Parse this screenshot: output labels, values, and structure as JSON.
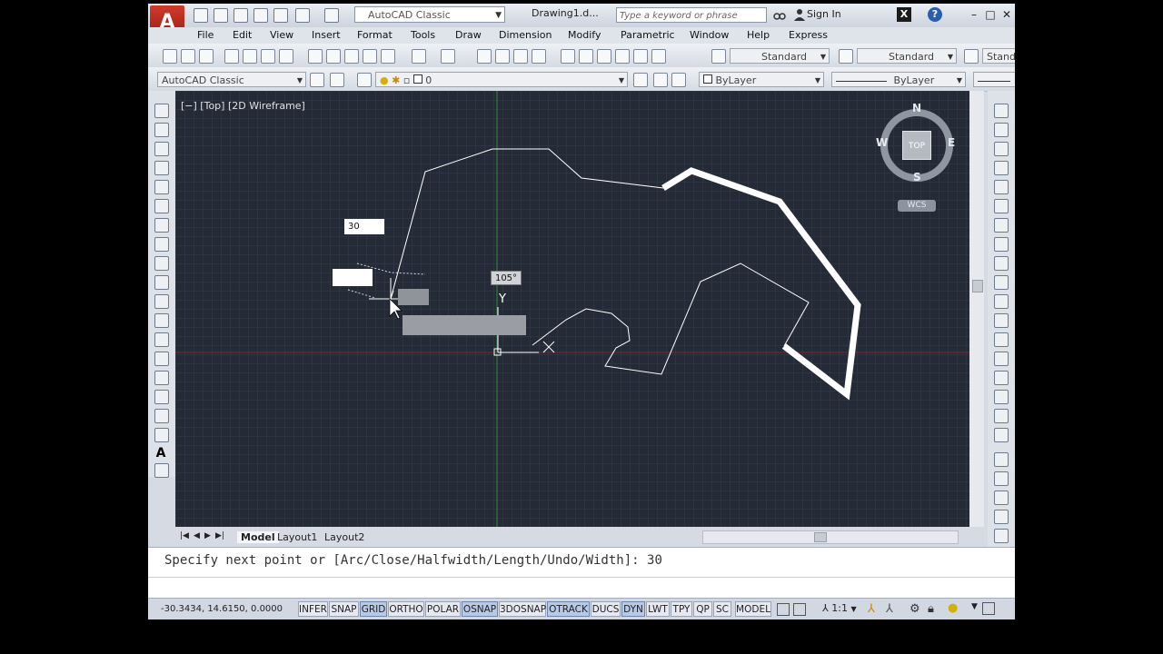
{
  "title_bar": {
    "workspace": "AutoCAD Classic",
    "document": "Drawing1.d...",
    "search_placeholder": "Type a keyword or phrase",
    "sign_in": "Sign In"
  },
  "menu": [
    "File",
    "Edit",
    "View",
    "Insert",
    "Format",
    "Tools",
    "Draw",
    "Dimension",
    "Modify",
    "Parametric",
    "Window",
    "Help",
    "Express"
  ],
  "toolbar1": {
    "text_style": "Standard",
    "dim_style": "Standard",
    "table_style": "Stand"
  },
  "toolbar2": {
    "workspace": "AutoCAD Classic",
    "layer": "0",
    "color": "ByLayer",
    "linetype": "ByLayer"
  },
  "viewport": {
    "label": "[−] [Top] [2D Wireframe]",
    "compass": {
      "n": "N",
      "s": "S",
      "e": "E",
      "w": "W",
      "center": "TOP"
    },
    "ucs": "WCS"
  },
  "dynamic_input": {
    "length_value": "30",
    "angle_value": "105°",
    "y_axis": "Y"
  },
  "layout_tabs": [
    "Model",
    "Layout1",
    "Layout2"
  ],
  "command_line": "Specify next point or [Arc/Close/Halfwidth/Length/Undo/Width]: 30",
  "status": {
    "coords": "-30.3434, 14.6150, 0.0000",
    "toggles": [
      {
        "label": "INFER",
        "on": false
      },
      {
        "label": "SNAP",
        "on": false
      },
      {
        "label": "GRID",
        "on": true
      },
      {
        "label": "ORTHO",
        "on": false
      },
      {
        "label": "POLAR",
        "on": false
      },
      {
        "label": "OSNAP",
        "on": true
      },
      {
        "label": "3DOSNAP",
        "on": false
      },
      {
        "label": "OTRACK",
        "on": true
      },
      {
        "label": "DUCS",
        "on": false
      },
      {
        "label": "DYN",
        "on": true
      },
      {
        "label": "LWT",
        "on": false
      },
      {
        "label": "TPY",
        "on": false
      },
      {
        "label": "QP",
        "on": false
      },
      {
        "label": "SC",
        "on": false
      }
    ],
    "model": "MODEL",
    "scale": "1:1"
  },
  "colors": {
    "canvas": "#252b36",
    "grid": "#2e3542",
    "active_toggle": "#b8c9e6",
    "brand_red": "#c0392b"
  }
}
